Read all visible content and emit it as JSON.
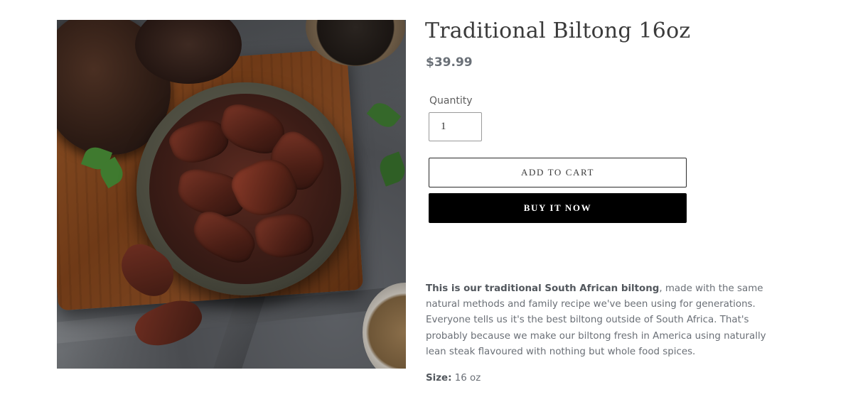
{
  "product": {
    "title": "Traditional Biltong 16oz",
    "price": "$39.99",
    "image_alt": "Bowl of traditional biltong on a wooden board"
  },
  "quantity": {
    "label": "Quantity",
    "value": "1"
  },
  "buttons": {
    "add_to_cart": "Add to cart",
    "buy_now": "Buy it now"
  },
  "description": {
    "lead": "This is our traditional South African biltong",
    "body": ", made with the same natural methods and family recipe we've been using for generations. Everyone tells us it's the best biltong outside of South Africa. That's probably because we make our biltong fresh in America using naturally lean steak flavoured with nothing but whole food spices."
  },
  "size": {
    "label": "Size:",
    "value": " 16 oz"
  },
  "colors": {
    "buy_button": "#000000",
    "price": "#6a7077"
  }
}
